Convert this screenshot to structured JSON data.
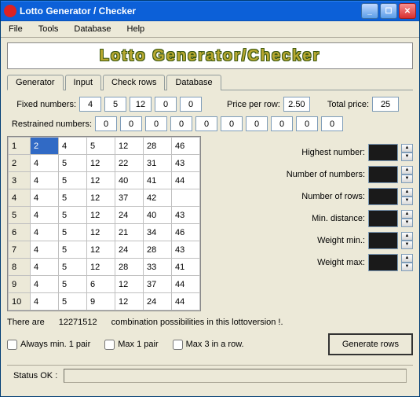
{
  "window": {
    "title": "Lotto Generator / Checker"
  },
  "menubar": {
    "file": "File",
    "tools": "Tools",
    "database": "Database",
    "help": "Help"
  },
  "logo": "Lotto Generator/Checker",
  "tabs": {
    "generator": "Generator",
    "input": "Input",
    "check_rows": "Check rows",
    "database": "Database"
  },
  "labels": {
    "fixed_numbers": "Fixed numbers:",
    "price_per_row": "Price per row:",
    "total_price": "Total price:",
    "restrained_numbers": "Restrained numbers:",
    "highest_number": "Highest number:",
    "number_of_numbers": "Number of numbers:",
    "number_of_rows": "Number of rows:",
    "min_distance": "Min. distance:",
    "weight_min": "Weight min.:",
    "weight_max": "Weight max:",
    "always_min_1_pair": "Always min. 1 pair",
    "max_1_pair": "Max 1 pair",
    "max_3_in_a_row": "Max 3 in a row.",
    "generate_rows": "Generate rows",
    "status": "Status OK :"
  },
  "fixed_numbers": [
    "4",
    "5",
    "12",
    "0",
    "0"
  ],
  "price_per_row": "2.50",
  "total_price": "25",
  "restrained_numbers": [
    "0",
    "0",
    "0",
    "0",
    "0",
    "0",
    "0",
    "0",
    "0",
    "0"
  ],
  "grid": [
    {
      "n": "1",
      "cells": [
        "2",
        "4",
        "5",
        "12",
        "28",
        "46"
      ]
    },
    {
      "n": "2",
      "cells": [
        "4",
        "5",
        "12",
        "22",
        "31",
        "43"
      ]
    },
    {
      "n": "3",
      "cells": [
        "4",
        "5",
        "12",
        "40",
        "41",
        "44"
      ]
    },
    {
      "n": "4",
      "cells": [
        "4",
        "5",
        "12",
        "37",
        "42",
        ""
      ]
    },
    {
      "n": "5",
      "cells": [
        "4",
        "5",
        "12",
        "24",
        "40",
        "43"
      ]
    },
    {
      "n": "6",
      "cells": [
        "4",
        "5",
        "12",
        "21",
        "34",
        "46"
      ]
    },
    {
      "n": "7",
      "cells": [
        "4",
        "5",
        "12",
        "24",
        "28",
        "43"
      ]
    },
    {
      "n": "8",
      "cells": [
        "4",
        "5",
        "12",
        "28",
        "33",
        "41"
      ]
    },
    {
      "n": "9",
      "cells": [
        "4",
        "5",
        "6",
        "12",
        "37",
        "44"
      ]
    },
    {
      "n": "10",
      "cells": [
        "4",
        "5",
        "9",
        "12",
        "24",
        "44"
      ]
    }
  ],
  "combo_text_prefix": "There are",
  "combo_value": "12271512",
  "combo_text_suffix": "combination possibilities in this lottoversion !."
}
